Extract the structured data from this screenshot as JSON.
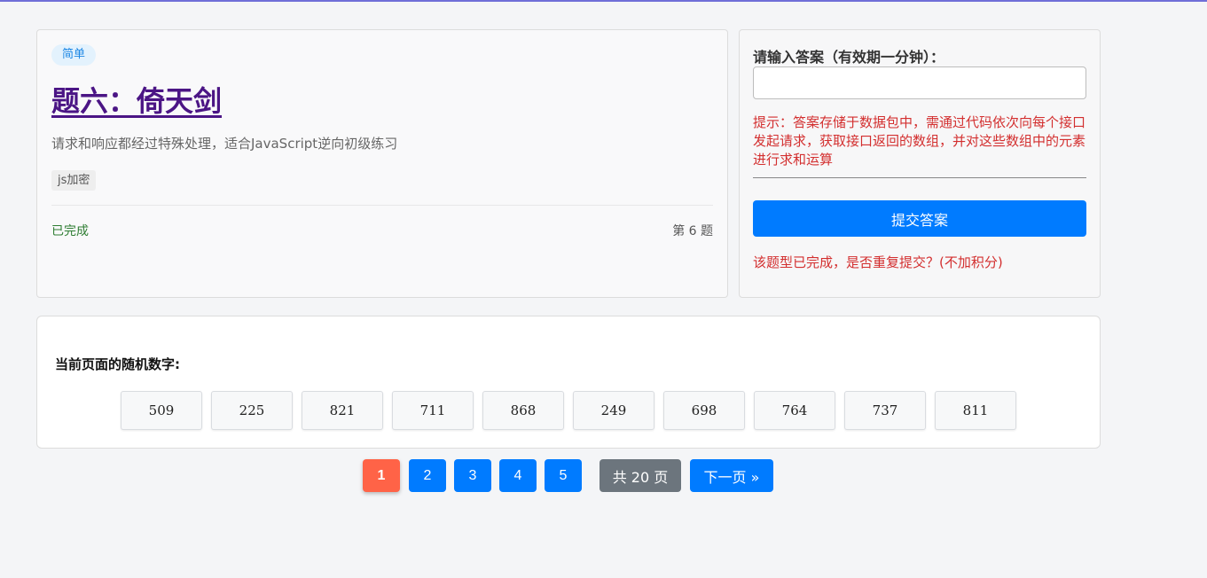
{
  "card": {
    "difficulty": "简单",
    "title": "题六：倚天剑",
    "description": "请求和响应都经过特殊处理，适合JavaScript逆向初级练习",
    "tag": "js加密",
    "status": "已完成",
    "question_number": "第 6 题"
  },
  "answer": {
    "label": "请输入答案（有效期一分钟）：",
    "input_value": "",
    "hint": "提示：答案存储于数据包中，需通过代码依次向每个接口发起请求，获取接口返回的数组，并对这些数组中的元素进行求和运算",
    "submit_label": "提交答案",
    "completed_message": "该题型已完成，是否重复提交？(不加积分)"
  },
  "random": {
    "title": "当前页面的随机数字:",
    "numbers": [
      "509",
      "225",
      "821",
      "711",
      "868",
      "249",
      "698",
      "764",
      "737",
      "811"
    ]
  },
  "pagination": {
    "pages": [
      "1",
      "2",
      "3",
      "4",
      "5"
    ],
    "current": "1",
    "total_label": "共 20 页",
    "next_label": "下一页 »"
  },
  "colors": {
    "accent": "#007bff",
    "active_page": "#ff6347",
    "title": "#4b1585",
    "error": "#d32f2f",
    "success": "#2e7d32"
  }
}
